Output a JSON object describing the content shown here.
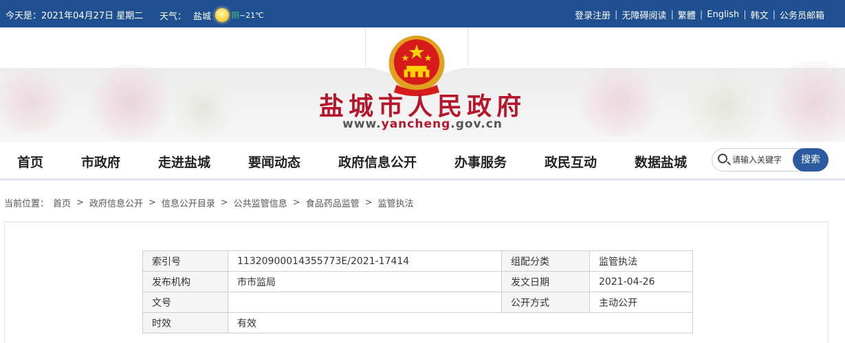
{
  "topbar": {
    "today": "今天是：2021年04月27日 星期二",
    "weather_label": "天气：",
    "city": "盐城",
    "temp_prefix": "阴",
    "temp": "~21℃",
    "links": [
      "登录注册",
      "无障碍阅读",
      "繁體",
      "English",
      "韩文",
      "公务员邮箱"
    ]
  },
  "banner": {
    "title": "盐城市人民政府",
    "url_pre": "www.",
    "url_hl": "yancheng",
    "url_post": ".gov.cn"
  },
  "nav": {
    "items": [
      "首页",
      "市政府",
      "走进盐城",
      "要闻动态",
      "政府信息公开",
      "办事服务",
      "政民互动",
      "数据盐城"
    ],
    "search_placeholder": "请输入关键字",
    "search_button": "搜索"
  },
  "breadcrumb": {
    "label": "当前位置：",
    "items": [
      "首页",
      "政府信息公开",
      "信息公开目录",
      "公共监管信息",
      "食品药品监管",
      "监管执法"
    ]
  },
  "meta": {
    "rows": [
      {
        "k1": "索引号",
        "v1": "11320900014355773E/2021-17414",
        "k2": "组配分类",
        "v2": "监管执法"
      },
      {
        "k1": "发布机构",
        "v1": "市市监局",
        "k2": "发文日期",
        "v2": "2021-04-26"
      },
      {
        "k1": "文号",
        "v1": "",
        "k2": "公开方式",
        "v2": "主动公开"
      },
      {
        "k1": "时效",
        "v1": "有效"
      }
    ]
  },
  "colors": {
    "topbar": "#1d4f91",
    "title_red": "#b5162b",
    "search_button": "#2c5aa0"
  }
}
